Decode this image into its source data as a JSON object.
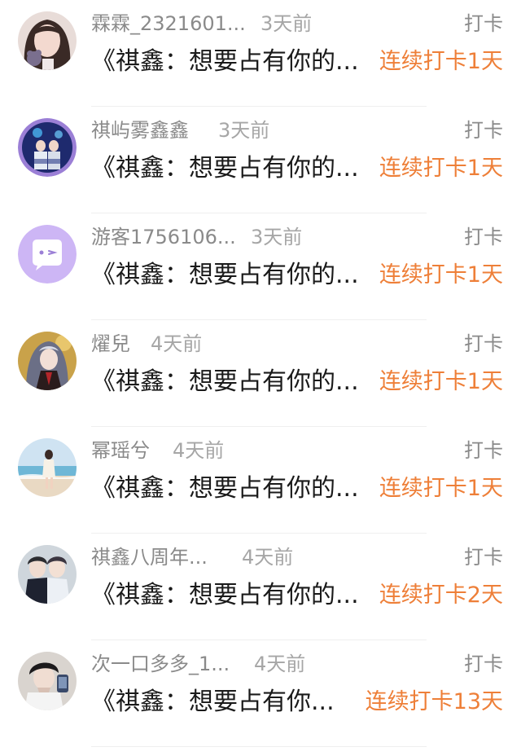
{
  "accent_color": "#ee7f38",
  "items": [
    {
      "username": "霖霖_2321601...",
      "time": "3天前",
      "action": "打卡",
      "content": "《祺鑫：想要占有你的...",
      "streak": "连续打卡1天",
      "avatar_icon": "girl-selfie-avatar"
    },
    {
      "username": "祺屿雾鑫鑫",
      "time": "3天前",
      "action": "打卡",
      "content": "《祺鑫：想要占有你的...",
      "streak": "连续打卡1天",
      "avatar_icon": "stage-performers-avatar"
    },
    {
      "username": "游客1756106...",
      "time": "3天前",
      "action": "打卡",
      "content": "《祺鑫：想要占有你的...",
      "streak": "连续打卡1天",
      "avatar_icon": "guest-chat-bubble-avatar"
    },
    {
      "username": "燿兒",
      "time": "4天前",
      "action": "打卡",
      "content": "《祺鑫：想要占有你的...",
      "streak": "连续打卡1天",
      "avatar_icon": "anime-character-avatar"
    },
    {
      "username": "幂瑶兮",
      "time": "4天前",
      "action": "打卡",
      "content": "《祺鑫：想要占有你的...",
      "streak": "连续打卡1天",
      "avatar_icon": "beach-girl-avatar"
    },
    {
      "username": "祺鑫八周年...",
      "time": "4天前",
      "action": "打卡",
      "content": "《祺鑫：想要占有你的...",
      "streak": "连续打卡2天",
      "avatar_icon": "two-boys-avatar"
    },
    {
      "username": "次一口多多_1...",
      "time": "4天前",
      "action": "打卡",
      "content": "《祺鑫：想要占有你...",
      "streak": "连续打卡13天",
      "avatar_icon": "boy-selfie-avatar"
    }
  ]
}
